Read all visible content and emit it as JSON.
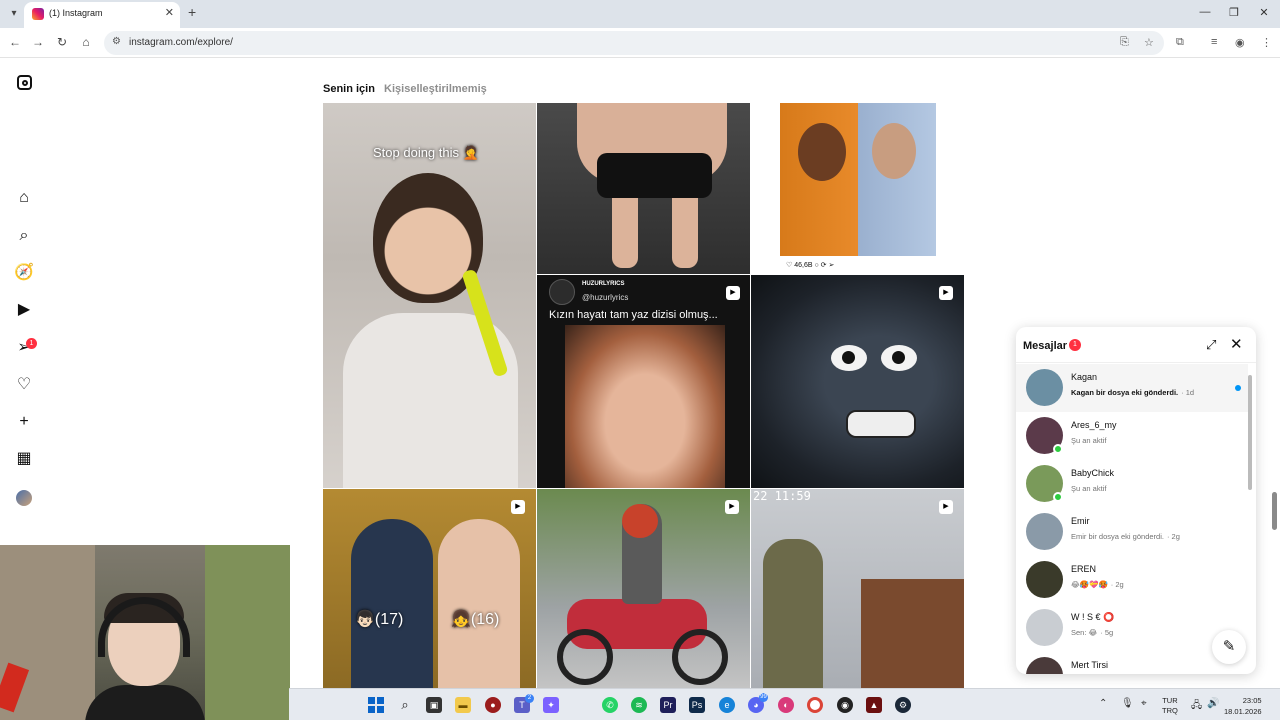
{
  "browser": {
    "tab_title": "(1) Instagram",
    "new_tab_symbol": "+",
    "url": "instagram.com/explore/",
    "window_controls": [
      "—",
      "❐",
      "✕"
    ]
  },
  "instagram": {
    "sidebar_icons": [
      "instagram-logo-icon",
      "home-icon",
      "search-icon",
      "explore-icon",
      "reels-icon",
      "notifications-icon",
      "heart-icon",
      "create-icon",
      "dashboard-icon",
      "profile-avatar"
    ],
    "notification_count": "1",
    "explore_tabs": {
      "active": "Senin için",
      "inactive": "Kişiselleştirilmemiş"
    },
    "posts": {
      "p1_caption": "Stop doing this 🤦",
      "p3_likes": "46,6B",
      "p4_account": "HUZURLYRICS",
      "p4_handle": "@huzurlyrics",
      "p4_caption": "Kızın hayatı tam yaz dizisi olmuş...",
      "p6_label_left": "👦🏻(17)",
      "p6_label_right": "👧(16)",
      "p8_timestamp": "22 11:59"
    }
  },
  "messages": {
    "title": "Mesajlar",
    "unread_badge": "1",
    "conversations": [
      {
        "name": "Kagan",
        "preview": "Kagan bir dosya eki gönderdi.",
        "time": "· 1d",
        "unread": true,
        "online": false,
        "avatar_color": "#6b8fa3"
      },
      {
        "name": "Ares_6_my",
        "preview": "Şu an aktif",
        "time": "",
        "unread": false,
        "online": true,
        "avatar_color": "#5b3a4a"
      },
      {
        "name": "BabyChick",
        "preview": "Şu an aktif",
        "time": "",
        "unread": false,
        "online": true,
        "avatar_color": "#7a9a5a"
      },
      {
        "name": "Emir",
        "preview": "Emir bir dosya eki gönderdi.",
        "time": "· 2g",
        "unread": false,
        "online": false,
        "avatar_color": "#8a9aa8"
      },
      {
        "name": "EREN",
        "preview": "😂🥵💝🥵",
        "time": "· 2g",
        "unread": false,
        "online": false,
        "avatar_color": "#3a3a2a"
      },
      {
        "name": "W ! S € ⭕",
        "preview": "Sen: 😂",
        "time": "· 5g",
        "unread": false,
        "online": false,
        "avatar_color": "#c9cdd2"
      },
      {
        "name": "Mert Tirsi",
        "preview": "",
        "time": "",
        "unread": false,
        "online": false,
        "avatar_color": "#4a3a3a"
      }
    ]
  },
  "taskbar": {
    "lang_top": "TUR",
    "lang_bottom": "TRQ",
    "time": "23:05",
    "date": "18.01.2026",
    "badges": {
      "teams": "2",
      "discord": "99"
    }
  }
}
